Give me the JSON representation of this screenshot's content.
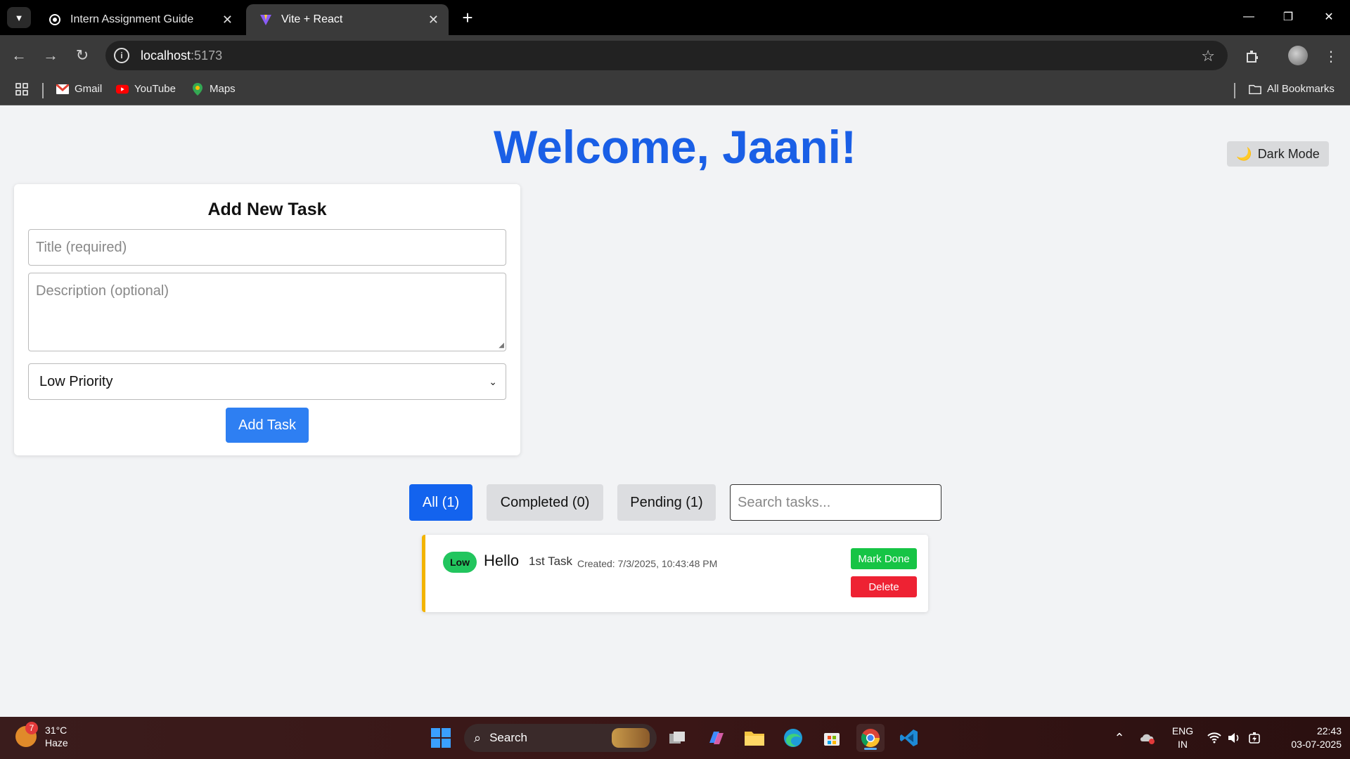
{
  "browser": {
    "tabs": [
      {
        "title": "Intern Assignment Guide",
        "active": false
      },
      {
        "title": "Vite + React",
        "active": true
      }
    ],
    "url_host": "localhost",
    "url_port": ":5173",
    "bookmarks": [
      "Gmail",
      "YouTube",
      "Maps"
    ],
    "all_bookmarks": "All Bookmarks"
  },
  "page": {
    "welcome": "Welcome, Jaani!",
    "dark_mode_label": "Dark Mode",
    "dark_mode_icon": "🌙",
    "form": {
      "title": "Add New Task",
      "title_placeholder": "Title (required)",
      "description_placeholder": "Description (optional)",
      "priority_selected": "Low Priority",
      "add_button": "Add Task"
    },
    "filters": {
      "all": "All (1)",
      "completed": "Completed (0)",
      "pending": "Pending (1)",
      "search_placeholder": "Search tasks..."
    },
    "tasks": [
      {
        "priority": "Low",
        "title": "Hello",
        "description": "1st Task",
        "created": "Created: 7/3/2025, 10:43:48 PM",
        "done_label": "Mark Done",
        "delete_label": "Delete"
      }
    ]
  },
  "taskbar": {
    "weather_temp": "31°C",
    "weather_cond": "Haze",
    "weather_badge": "7",
    "search_label": "Search",
    "lang_line1": "ENG",
    "lang_line2": "IN",
    "time": "22:43",
    "date": "03-07-2025"
  },
  "colors": {
    "accent": "#1a5fe6",
    "primary_button": "#2e7ff2",
    "done": "#16c445",
    "delete": "#ee2233",
    "low_badge": "#22c55e",
    "task_border": "#f3b400"
  }
}
